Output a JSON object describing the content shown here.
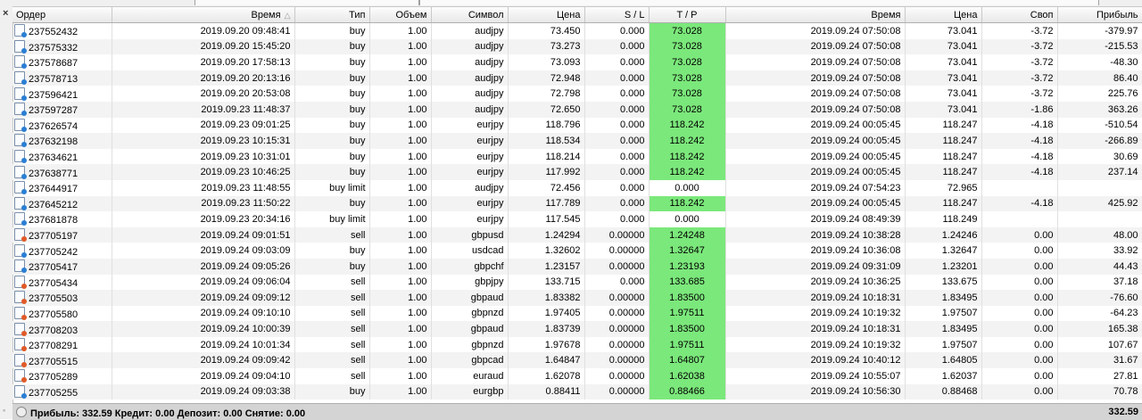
{
  "panel": {
    "close_glyph": "×"
  },
  "columns": {
    "order": "Ордер",
    "open_time": "Время",
    "type": "Тип",
    "volume": "Объем",
    "symbol": "Символ",
    "open_price": "Цена",
    "sl": "S / L",
    "tp": "T / P",
    "close_time": "Время",
    "close_price": "Цена",
    "swap": "Своп",
    "profit": "Прибыль"
  },
  "colors": {
    "tp_hit": "#7be87b",
    "buy_icon": "#2a7fd4",
    "sell_icon": "#e05a28"
  },
  "rows": [
    {
      "order": "237552432",
      "open_time": "2019.09.20 09:48:41",
      "type": "buy",
      "volume": "1.00",
      "symbol": "audjpy",
      "open_price": "73.450",
      "sl": "0.000",
      "tp": "73.028",
      "tp_hit": true,
      "close_time": "2019.09.24 07:50:08",
      "close_price": "73.041",
      "swap": "-3.72",
      "profit": "-379.97"
    },
    {
      "order": "237575332",
      "open_time": "2019.09.20 15:45:20",
      "type": "buy",
      "volume": "1.00",
      "symbol": "audjpy",
      "open_price": "73.273",
      "sl": "0.000",
      "tp": "73.028",
      "tp_hit": true,
      "close_time": "2019.09.24 07:50:08",
      "close_price": "73.041",
      "swap": "-3.72",
      "profit": "-215.53"
    },
    {
      "order": "237578687",
      "open_time": "2019.09.20 17:58:13",
      "type": "buy",
      "volume": "1.00",
      "symbol": "audjpy",
      "open_price": "73.093",
      "sl": "0.000",
      "tp": "73.028",
      "tp_hit": true,
      "close_time": "2019.09.24 07:50:08",
      "close_price": "73.041",
      "swap": "-3.72",
      "profit": "-48.30"
    },
    {
      "order": "237578713",
      "open_time": "2019.09.20 20:13:16",
      "type": "buy",
      "volume": "1.00",
      "symbol": "audjpy",
      "open_price": "72.948",
      "sl": "0.000",
      "tp": "73.028",
      "tp_hit": true,
      "close_time": "2019.09.24 07:50:08",
      "close_price": "73.041",
      "swap": "-3.72",
      "profit": "86.40"
    },
    {
      "order": "237596421",
      "open_time": "2019.09.20 20:53:08",
      "type": "buy",
      "volume": "1.00",
      "symbol": "audjpy",
      "open_price": "72.798",
      "sl": "0.000",
      "tp": "73.028",
      "tp_hit": true,
      "close_time": "2019.09.24 07:50:08",
      "close_price": "73.041",
      "swap": "-3.72",
      "profit": "225.76"
    },
    {
      "order": "237597287",
      "open_time": "2019.09.23 11:48:37",
      "type": "buy",
      "volume": "1.00",
      "symbol": "audjpy",
      "open_price": "72.650",
      "sl": "0.000",
      "tp": "73.028",
      "tp_hit": true,
      "close_time": "2019.09.24 07:50:08",
      "close_price": "73.041",
      "swap": "-1.86",
      "profit": "363.26"
    },
    {
      "order": "237626574",
      "open_time": "2019.09.23 09:01:25",
      "type": "buy",
      "volume": "1.00",
      "symbol": "eurjpy",
      "open_price": "118.796",
      "sl": "0.000",
      "tp": "118.242",
      "tp_hit": true,
      "close_time": "2019.09.24 00:05:45",
      "close_price": "118.247",
      "swap": "-4.18",
      "profit": "-510.54"
    },
    {
      "order": "237632198",
      "open_time": "2019.09.23 10:15:31",
      "type": "buy",
      "volume": "1.00",
      "symbol": "eurjpy",
      "open_price": "118.534",
      "sl": "0.000",
      "tp": "118.242",
      "tp_hit": true,
      "close_time": "2019.09.24 00:05:45",
      "close_price": "118.247",
      "swap": "-4.18",
      "profit": "-266.89"
    },
    {
      "order": "237634621",
      "open_time": "2019.09.23 10:31:01",
      "type": "buy",
      "volume": "1.00",
      "symbol": "eurjpy",
      "open_price": "118.214",
      "sl": "0.000",
      "tp": "118.242",
      "tp_hit": true,
      "close_time": "2019.09.24 00:05:45",
      "close_price": "118.247",
      "swap": "-4.18",
      "profit": "30.69"
    },
    {
      "order": "237638771",
      "open_time": "2019.09.23 10:46:25",
      "type": "buy",
      "volume": "1.00",
      "symbol": "eurjpy",
      "open_price": "117.992",
      "sl": "0.000",
      "tp": "118.242",
      "tp_hit": true,
      "close_time": "2019.09.24 00:05:45",
      "close_price": "118.247",
      "swap": "-4.18",
      "profit": "237.14"
    },
    {
      "order": "237644917",
      "open_time": "2019.09.23 11:48:55",
      "type": "buy limit",
      "volume": "1.00",
      "symbol": "audjpy",
      "open_price": "72.456",
      "sl": "0.000",
      "tp": "0.000",
      "tp_hit": false,
      "close_time": "2019.09.24 07:54:23",
      "close_price": "72.965",
      "swap": "",
      "profit": ""
    },
    {
      "order": "237645212",
      "open_time": "2019.09.23 11:50:22",
      "type": "buy",
      "volume": "1.00",
      "symbol": "eurjpy",
      "open_price": "117.789",
      "sl": "0.000",
      "tp": "118.242",
      "tp_hit": true,
      "close_time": "2019.09.24 00:05:45",
      "close_price": "118.247",
      "swap": "-4.18",
      "profit": "425.92"
    },
    {
      "order": "237681878",
      "open_time": "2019.09.23 20:34:16",
      "type": "buy limit",
      "volume": "1.00",
      "symbol": "eurjpy",
      "open_price": "117.545",
      "sl": "0.000",
      "tp": "0.000",
      "tp_hit": false,
      "close_time": "2019.09.24 08:49:39",
      "close_price": "118.249",
      "swap": "",
      "profit": ""
    },
    {
      "order": "237705197",
      "open_time": "2019.09.24 09:01:51",
      "type": "sell",
      "volume": "1.00",
      "symbol": "gbpusd",
      "open_price": "1.24294",
      "sl": "0.00000",
      "tp": "1.24248",
      "tp_hit": true,
      "close_time": "2019.09.24 10:38:28",
      "close_price": "1.24246",
      "swap": "0.00",
      "profit": "48.00"
    },
    {
      "order": "237705242",
      "open_time": "2019.09.24 09:03:09",
      "type": "buy",
      "volume": "1.00",
      "symbol": "usdcad",
      "open_price": "1.32602",
      "sl": "0.00000",
      "tp": "1.32647",
      "tp_hit": true,
      "close_time": "2019.09.24 10:36:08",
      "close_price": "1.32647",
      "swap": "0.00",
      "profit": "33.92"
    },
    {
      "order": "237705417",
      "open_time": "2019.09.24 09:05:26",
      "type": "buy",
      "volume": "1.00",
      "symbol": "gbpchf",
      "open_price": "1.23157",
      "sl": "0.00000",
      "tp": "1.23193",
      "tp_hit": true,
      "close_time": "2019.09.24 09:31:09",
      "close_price": "1.23201",
      "swap": "0.00",
      "profit": "44.43"
    },
    {
      "order": "237705434",
      "open_time": "2019.09.24 09:06:04",
      "type": "sell",
      "volume": "1.00",
      "symbol": "gbpjpy",
      "open_price": "133.715",
      "sl": "0.000",
      "tp": "133.685",
      "tp_hit": true,
      "close_time": "2019.09.24 10:36:25",
      "close_price": "133.675",
      "swap": "0.00",
      "profit": "37.18"
    },
    {
      "order": "237705503",
      "open_time": "2019.09.24 09:09:12",
      "type": "sell",
      "volume": "1.00",
      "symbol": "gbpaud",
      "open_price": "1.83382",
      "sl": "0.00000",
      "tp": "1.83500",
      "tp_hit": true,
      "close_time": "2019.09.24 10:18:31",
      "close_price": "1.83495",
      "swap": "0.00",
      "profit": "-76.60"
    },
    {
      "order": "237705580",
      "open_time": "2019.09.24 09:10:10",
      "type": "sell",
      "volume": "1.00",
      "symbol": "gbpnzd",
      "open_price": "1.97405",
      "sl": "0.00000",
      "tp": "1.97511",
      "tp_hit": true,
      "close_time": "2019.09.24 10:19:32",
      "close_price": "1.97507",
      "swap": "0.00",
      "profit": "-64.23"
    },
    {
      "order": "237708203",
      "open_time": "2019.09.24 10:00:39",
      "type": "sell",
      "volume": "1.00",
      "symbol": "gbpaud",
      "open_price": "1.83739",
      "sl": "0.00000",
      "tp": "1.83500",
      "tp_hit": true,
      "close_time": "2019.09.24 10:18:31",
      "close_price": "1.83495",
      "swap": "0.00",
      "profit": "165.38"
    },
    {
      "order": "237708291",
      "open_time": "2019.09.24 10:01:34",
      "type": "sell",
      "volume": "1.00",
      "symbol": "gbpnzd",
      "open_price": "1.97678",
      "sl": "0.00000",
      "tp": "1.97511",
      "tp_hit": true,
      "close_time": "2019.09.24 10:19:32",
      "close_price": "1.97507",
      "swap": "0.00",
      "profit": "107.67"
    },
    {
      "order": "237705515",
      "open_time": "2019.09.24 09:09:42",
      "type": "sell",
      "volume": "1.00",
      "symbol": "gbpcad",
      "open_price": "1.64847",
      "sl": "0.00000",
      "tp": "1.64807",
      "tp_hit": true,
      "close_time": "2019.09.24 10:40:12",
      "close_price": "1.64805",
      "swap": "0.00",
      "profit": "31.67"
    },
    {
      "order": "237705289",
      "open_time": "2019.09.24 09:04:10",
      "type": "sell",
      "volume": "1.00",
      "symbol": "euraud",
      "open_price": "1.62078",
      "sl": "0.00000",
      "tp": "1.62038",
      "tp_hit": true,
      "close_time": "2019.09.24 10:55:07",
      "close_price": "1.62037",
      "swap": "0.00",
      "profit": "27.81"
    },
    {
      "order": "237705255",
      "open_time": "2019.09.24 09:03:38",
      "type": "buy",
      "volume": "1.00",
      "symbol": "eurgbp",
      "open_price": "0.88411",
      "sl": "0.00000",
      "tp": "0.88466",
      "tp_hit": true,
      "close_time": "2019.09.24 10:56:30",
      "close_price": "0.88468",
      "swap": "0.00",
      "profit": "70.78"
    }
  ],
  "footer": {
    "summary": "Прибыль: 332.59  Кредит: 0.00  Депозит: 0.00  Снятие: 0.00",
    "total_profit": "332.59"
  }
}
